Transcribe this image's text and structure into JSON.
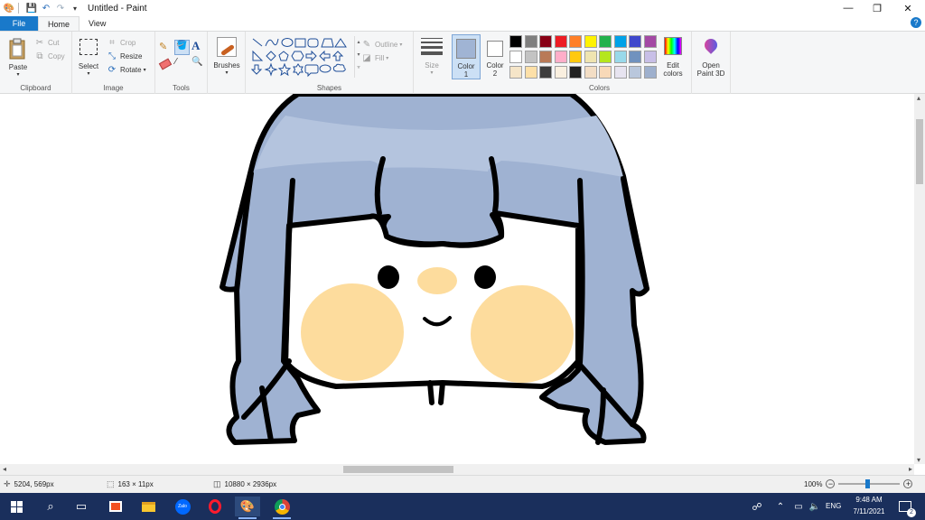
{
  "window": {
    "title": "Untitled - Paint"
  },
  "titlebar": {
    "minimize": "—",
    "maximize": "❐",
    "close": "✕"
  },
  "tabs": [
    {
      "label": "File"
    },
    {
      "label": "Home"
    },
    {
      "label": "View"
    }
  ],
  "clipboard": {
    "paste": "Paste",
    "cut": "Cut",
    "copy": "Copy",
    "group": "Clipboard"
  },
  "image": {
    "select": "Select",
    "crop": "Crop",
    "resize": "Resize",
    "rotate": "Rotate",
    "group": "Image"
  },
  "tools": {
    "group": "Tools"
  },
  "brushes": {
    "label": "Brushes"
  },
  "shapes": {
    "outline": "Outline",
    "fill": "Fill",
    "group": "Shapes"
  },
  "size": {
    "label": "Size"
  },
  "color1": {
    "label": "Color",
    "num": "1",
    "value": "#a0b4d4"
  },
  "color2": {
    "label": "Color",
    "num": "2",
    "value": "#ffffff"
  },
  "colors": {
    "group": "Colors",
    "edit_label": "Edit",
    "edit_label2": "colors",
    "palette_row1": [
      "#000000",
      "#7f7f7f",
      "#880015",
      "#ed1c24",
      "#ff7f27",
      "#fff200",
      "#22b14c",
      "#00a2e8",
      "#3f48cc",
      "#a349a4"
    ],
    "palette_row2": [
      "#ffffff",
      "#c3c3c3",
      "#b97a57",
      "#ffaec9",
      "#ffc90e",
      "#efe4b0",
      "#b5e61d",
      "#99d9ea",
      "#7092be",
      "#c8bfe7"
    ],
    "palette_row3": [
      "#f5e5c8",
      "#fde0a8",
      "#3d3d3d",
      "#faf0e0",
      "#222222",
      "#f3dec5",
      "#f8d9b8",
      "#e7e4f0",
      "#b9c7dc",
      "#9eb0cd"
    ]
  },
  "paint3d": {
    "label": "Open",
    "label2": "Paint 3D"
  },
  "status": {
    "cursor_pos": "5204, 569px",
    "selection_size": "163 × 11px",
    "canvas_size": "10880 × 2936px",
    "zoom": "100%"
  },
  "taskbar": {
    "lang": "ENG",
    "time": "9:48 AM",
    "date": "7/11/2021",
    "notif_count": "2",
    "zalo": "Zalo"
  },
  "drawing": {
    "hair_color": "#9fb2d2",
    "hair_band_color": "#b4c4de",
    "cheek_color": "#fddc9d",
    "outline_color": "#000000"
  }
}
